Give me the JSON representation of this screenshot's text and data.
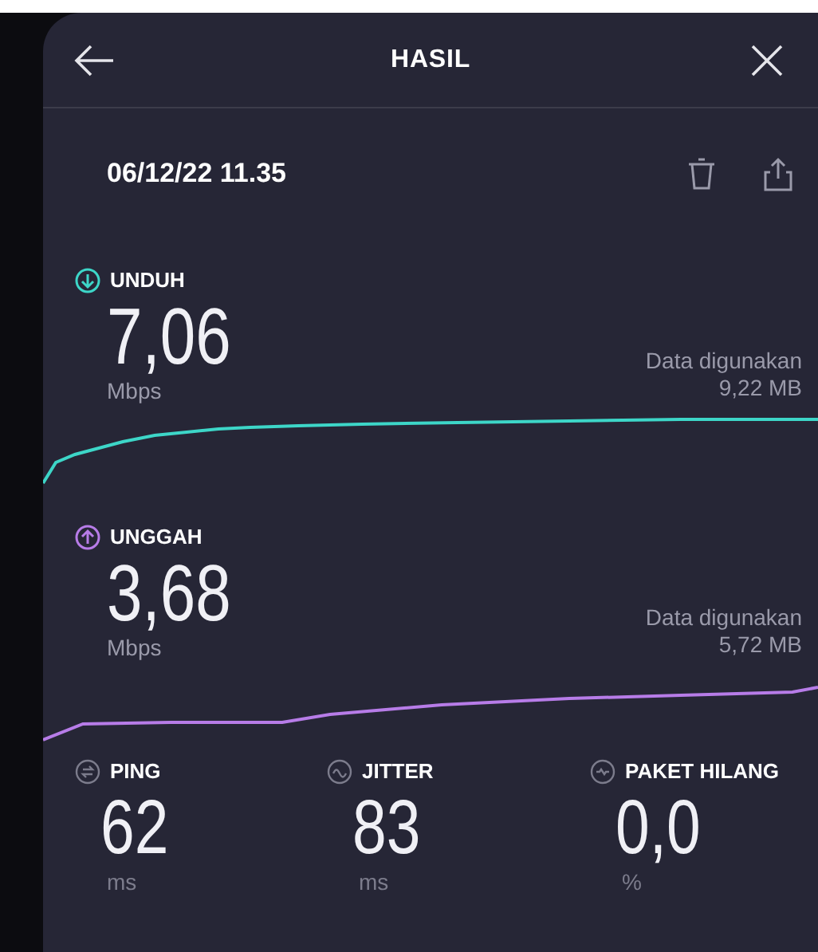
{
  "header": {
    "title": "HASIL"
  },
  "date": "06/12/22 11.35",
  "sections": [
    {
      "kind": "download",
      "color": "#3dd6c8",
      "label": "UNDUH",
      "value": "7,06",
      "unit": "Mbps",
      "data_label": "Data digunakan",
      "data_value": "9,22 MB"
    },
    {
      "kind": "upload",
      "color": "#b77ce8",
      "label": "UNGGAH",
      "value": "3,68",
      "unit": "Mbps",
      "data_label": "Data digunakan",
      "data_value": "5,72 MB"
    }
  ],
  "metrics": [
    {
      "kind": "ping",
      "label": "PING",
      "value": "62",
      "unit": "ms"
    },
    {
      "kind": "jitter",
      "label": "JITTER",
      "value": "83",
      "unit": "ms"
    },
    {
      "kind": "loss",
      "label": "PAKET HILANG",
      "value": "0,0",
      "unit": "%"
    }
  ]
}
